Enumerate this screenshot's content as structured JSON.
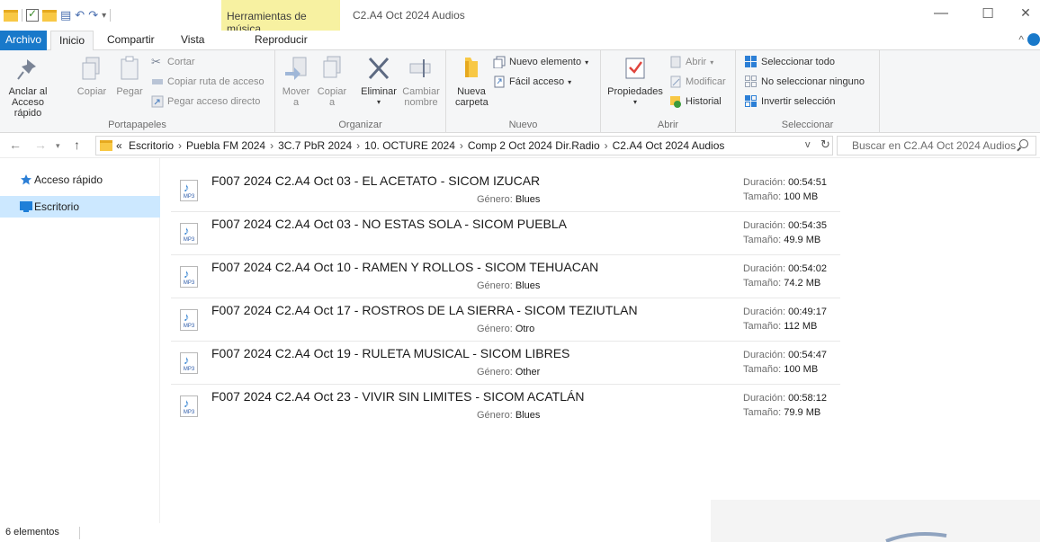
{
  "window": {
    "context_tab": "Herramientas de música",
    "title": "C2.A4 Oct 2024 Audios",
    "minimize": "—",
    "maximize": "☐",
    "close": "✕"
  },
  "tabs": {
    "file": "Archivo",
    "home": "Inicio",
    "share": "Compartir",
    "view": "Vista",
    "play": "Reproducir"
  },
  "ribbon": {
    "clipboard": {
      "label": "Portapapeles",
      "pin": [
        "Anclar al",
        "Acceso rápido"
      ],
      "copy": "Copiar",
      "paste": "Pegar",
      "cut": "Cortar",
      "copy_path": "Copiar ruta de acceso",
      "paste_shortcut": "Pegar acceso directo"
    },
    "organize": {
      "label": "Organizar",
      "move": [
        "Mover",
        "a"
      ],
      "copy_to": [
        "Copiar",
        "a"
      ],
      "delete": "Eliminar",
      "rename": [
        "Cambiar",
        "nombre"
      ]
    },
    "new": {
      "label": "Nuevo",
      "new_folder": [
        "Nueva",
        "carpeta"
      ],
      "new_item": "Nuevo elemento",
      "easy_access": "Fácil acceso"
    },
    "open": {
      "label": "Abrir",
      "properties": "Propiedades",
      "open": "Abrir",
      "edit": "Modificar",
      "history": "Historial"
    },
    "select": {
      "label": "Seleccionar",
      "select_all": "Seleccionar todo",
      "select_none": "No seleccionar ninguno",
      "invert": "Invertir selección"
    }
  },
  "address": {
    "prefix": "«",
    "crumbs": [
      "Escritorio",
      "Puebla FM 2024",
      "3C.7 PbR 2024",
      "10. OCTURE 2024",
      "Comp 2 Oct 2024 Dir.Radio",
      "C2.A4 Oct 2024 Audios"
    ],
    "search_placeholder": "Buscar en C2.A4 Oct 2024 Audios"
  },
  "nav": {
    "quick_access": "Acceso rápido",
    "desktop": "Escritorio"
  },
  "labels": {
    "genre": "Género:",
    "duration": "Duración:",
    "size": "Tamaño:",
    "file_type": "MP3"
  },
  "files": [
    {
      "name": "F007 2024 C2.A4 Oct 03 - EL ACETATO - SICOM IZUCAR",
      "genre": "Blues",
      "duration": "00:54:51",
      "size": "100 MB"
    },
    {
      "name": "F007 2024 C2.A4 Oct 03 - NO ESTAS SOLA  - SICOM PUEBLA",
      "genre": "",
      "duration": "00:54:35",
      "size": "49.9 MB"
    },
    {
      "name": "F007 2024 C2.A4 Oct 10 - RAMEN Y ROLLOS - SICOM TEHUACAN",
      "genre": "Blues",
      "duration": "00:54:02",
      "size": "74.2 MB"
    },
    {
      "name": "F007 2024 C2.A4 Oct 17 - ROSTROS DE LA SIERRA - SICOM TEZIUTLAN",
      "genre": "Otro",
      "duration": "00:49:17",
      "size": "112 MB"
    },
    {
      "name": "F007 2024 C2.A4 Oct 19 - RULETA MUSICAL  - SICOM LIBRES",
      "genre": "Other",
      "duration": "00:54:47",
      "size": "100 MB"
    },
    {
      "name": "F007 2024 C2.A4 Oct 23 - VIVIR SIN LIMITES - SICOM ACATLÁN",
      "genre": "Blues",
      "duration": "00:58:12",
      "size": "79.9 MB"
    }
  ],
  "status": {
    "count": "6 elementos"
  },
  "colors": {
    "accent": "#1979ca",
    "tool_tab": "#f7f1a1",
    "selection": "#cce8ff",
    "folder": "#f8c845"
  }
}
